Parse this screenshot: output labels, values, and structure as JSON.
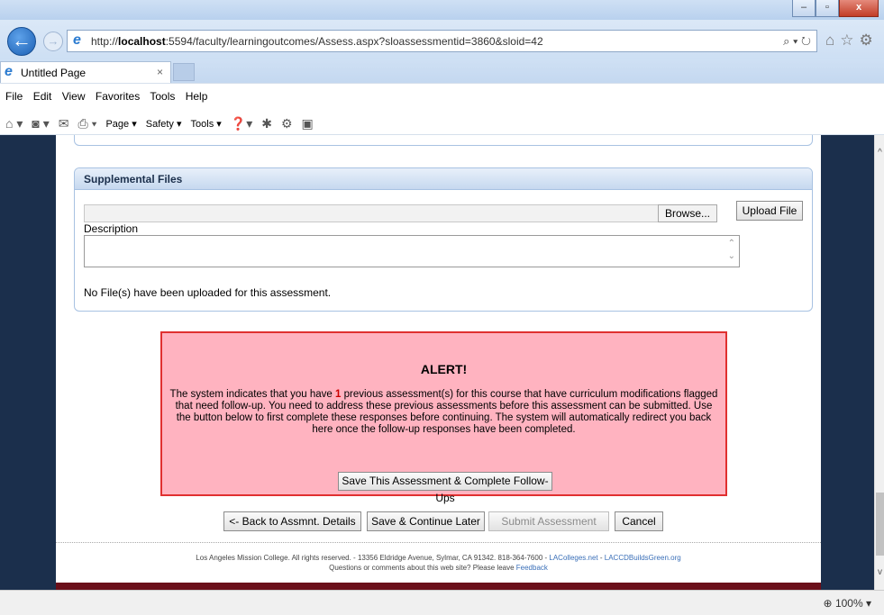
{
  "browser": {
    "url_prefix": "http://",
    "url_host": "localhost",
    "url_rest": ":5594/faculty/learningoutcomes/Assess.aspx?sloassessmentid=3860&sloid=42",
    "tab_title": "Untitled Page",
    "menu": [
      "File",
      "Edit",
      "View",
      "Favorites",
      "Tools",
      "Help"
    ],
    "commands": {
      "page": "Page ▾",
      "safety": "Safety ▾",
      "tools": "Tools ▾"
    },
    "zoom": "100%"
  },
  "supplemental": {
    "title": "Supplemental Files",
    "browse_label": "Browse...",
    "upload_label": "Upload File",
    "description_label": "Description",
    "no_files_text": "No File(s) have been uploaded for this assessment."
  },
  "alert": {
    "title": "ALERT!",
    "text_before": "The system indicates that you have ",
    "count": "1",
    "text_after": "  previous assessment(s) for this course that have curriculum modifications flagged that need follow-up. You need to address these previous assessments before this assessment can be submitted. Use the button below to first complete these responses before continuing. The system will automatically redirect you back here once the follow-up responses have been completed.",
    "button_label": "Save This Assessment & Complete Follow-Ups"
  },
  "actions": {
    "back_label": "<- Back to Assmnt. Details",
    "save_later_label": "Save & Continue Later",
    "submit_label": "Submit Assessment",
    "cancel_label": "Cancel"
  },
  "footer": {
    "line1": "Los Angeles Mission College. All rights reserved. - 13356 Eldridge Avenue, Sylmar, CA 91342. 818-364-7600 - ",
    "link1": "LAColleges.net",
    "sep": " - ",
    "link2": "LACCDBuildsGreen.org",
    "line2": "Questions or comments about this web site? Please leave ",
    "link3": "Feedback"
  },
  "colors": {
    "alert_bg": "#ffb3c0",
    "alert_border": "#e03030",
    "page_bg": "#1b2f4c"
  }
}
